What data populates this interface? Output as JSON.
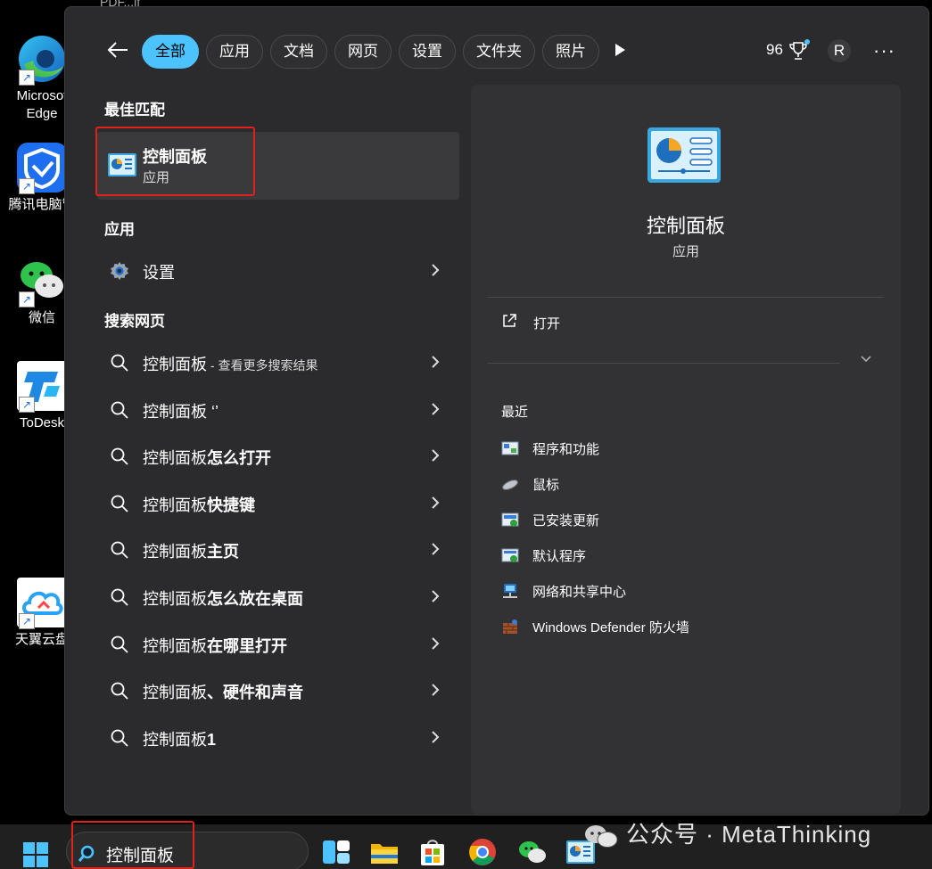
{
  "desktop": {
    "icons": [
      {
        "label": "Microsoft Edge",
        "line1": "Microsof",
        "line2": "Edge"
      },
      {
        "label": "腾讯电脑管"
      },
      {
        "label": "微信"
      },
      {
        "label": "ToDesk"
      },
      {
        "label": "天翼云盘"
      }
    ],
    "partial_top_label": "PDF...lf"
  },
  "search_panel": {
    "filters": [
      {
        "label": "全部",
        "active": true
      },
      {
        "label": "应用"
      },
      {
        "label": "文档"
      },
      {
        "label": "网页"
      },
      {
        "label": "设置"
      },
      {
        "label": "文件夹"
      },
      {
        "label": "照片"
      }
    ],
    "points": "96",
    "avatar_initial": "R",
    "more_label": "···",
    "best_match": {
      "section": "最佳匹配",
      "title": "控制面板",
      "subtitle": "应用"
    },
    "apps_section": "应用",
    "apps": [
      {
        "label": "设置"
      }
    ],
    "web_section": "搜索网页",
    "web_results": [
      {
        "prefix": "控制面板",
        "suffix": " - 查看更多搜索结果",
        "suffix_small": true
      },
      {
        "prefix": "控制面板",
        "suffix": " ‘’",
        "suffix_small": false
      },
      {
        "prefix": "控制面板",
        "bold": "怎么打开"
      },
      {
        "prefix": "控制面板",
        "bold": "快捷键"
      },
      {
        "prefix": "控制面板",
        "bold": "主页"
      },
      {
        "prefix": "控制面板",
        "bold": "怎么放在桌面"
      },
      {
        "prefix": "控制面板",
        "bold": "在哪里打开"
      },
      {
        "prefix": "控制面板",
        "bold": "、硬件和声音"
      },
      {
        "prefix": "控制面板",
        "bold": "1"
      }
    ]
  },
  "detail": {
    "title": "控制面板",
    "subtitle": "应用",
    "open_label": "打开",
    "recent_header": "最近",
    "recent": [
      {
        "label": "程序和功能",
        "icon": "programs-icon"
      },
      {
        "label": "鼠标",
        "icon": "mouse-icon"
      },
      {
        "label": "已安装更新",
        "icon": "updates-icon"
      },
      {
        "label": "默认程序",
        "icon": "default-programs-icon"
      },
      {
        "label": "网络和共享中心",
        "icon": "network-icon"
      },
      {
        "label": "Windows Defender 防火墙",
        "icon": "firewall-icon"
      }
    ]
  },
  "taskbar": {
    "search_value": "控制面板"
  },
  "watermark": {
    "text": "公众号 · MetaThinking"
  },
  "colors": {
    "accent": "#4cc2ff",
    "highlight_box": "#e0211c",
    "panel_bg": "#2b2b2d",
    "detail_bg": "#323234"
  }
}
